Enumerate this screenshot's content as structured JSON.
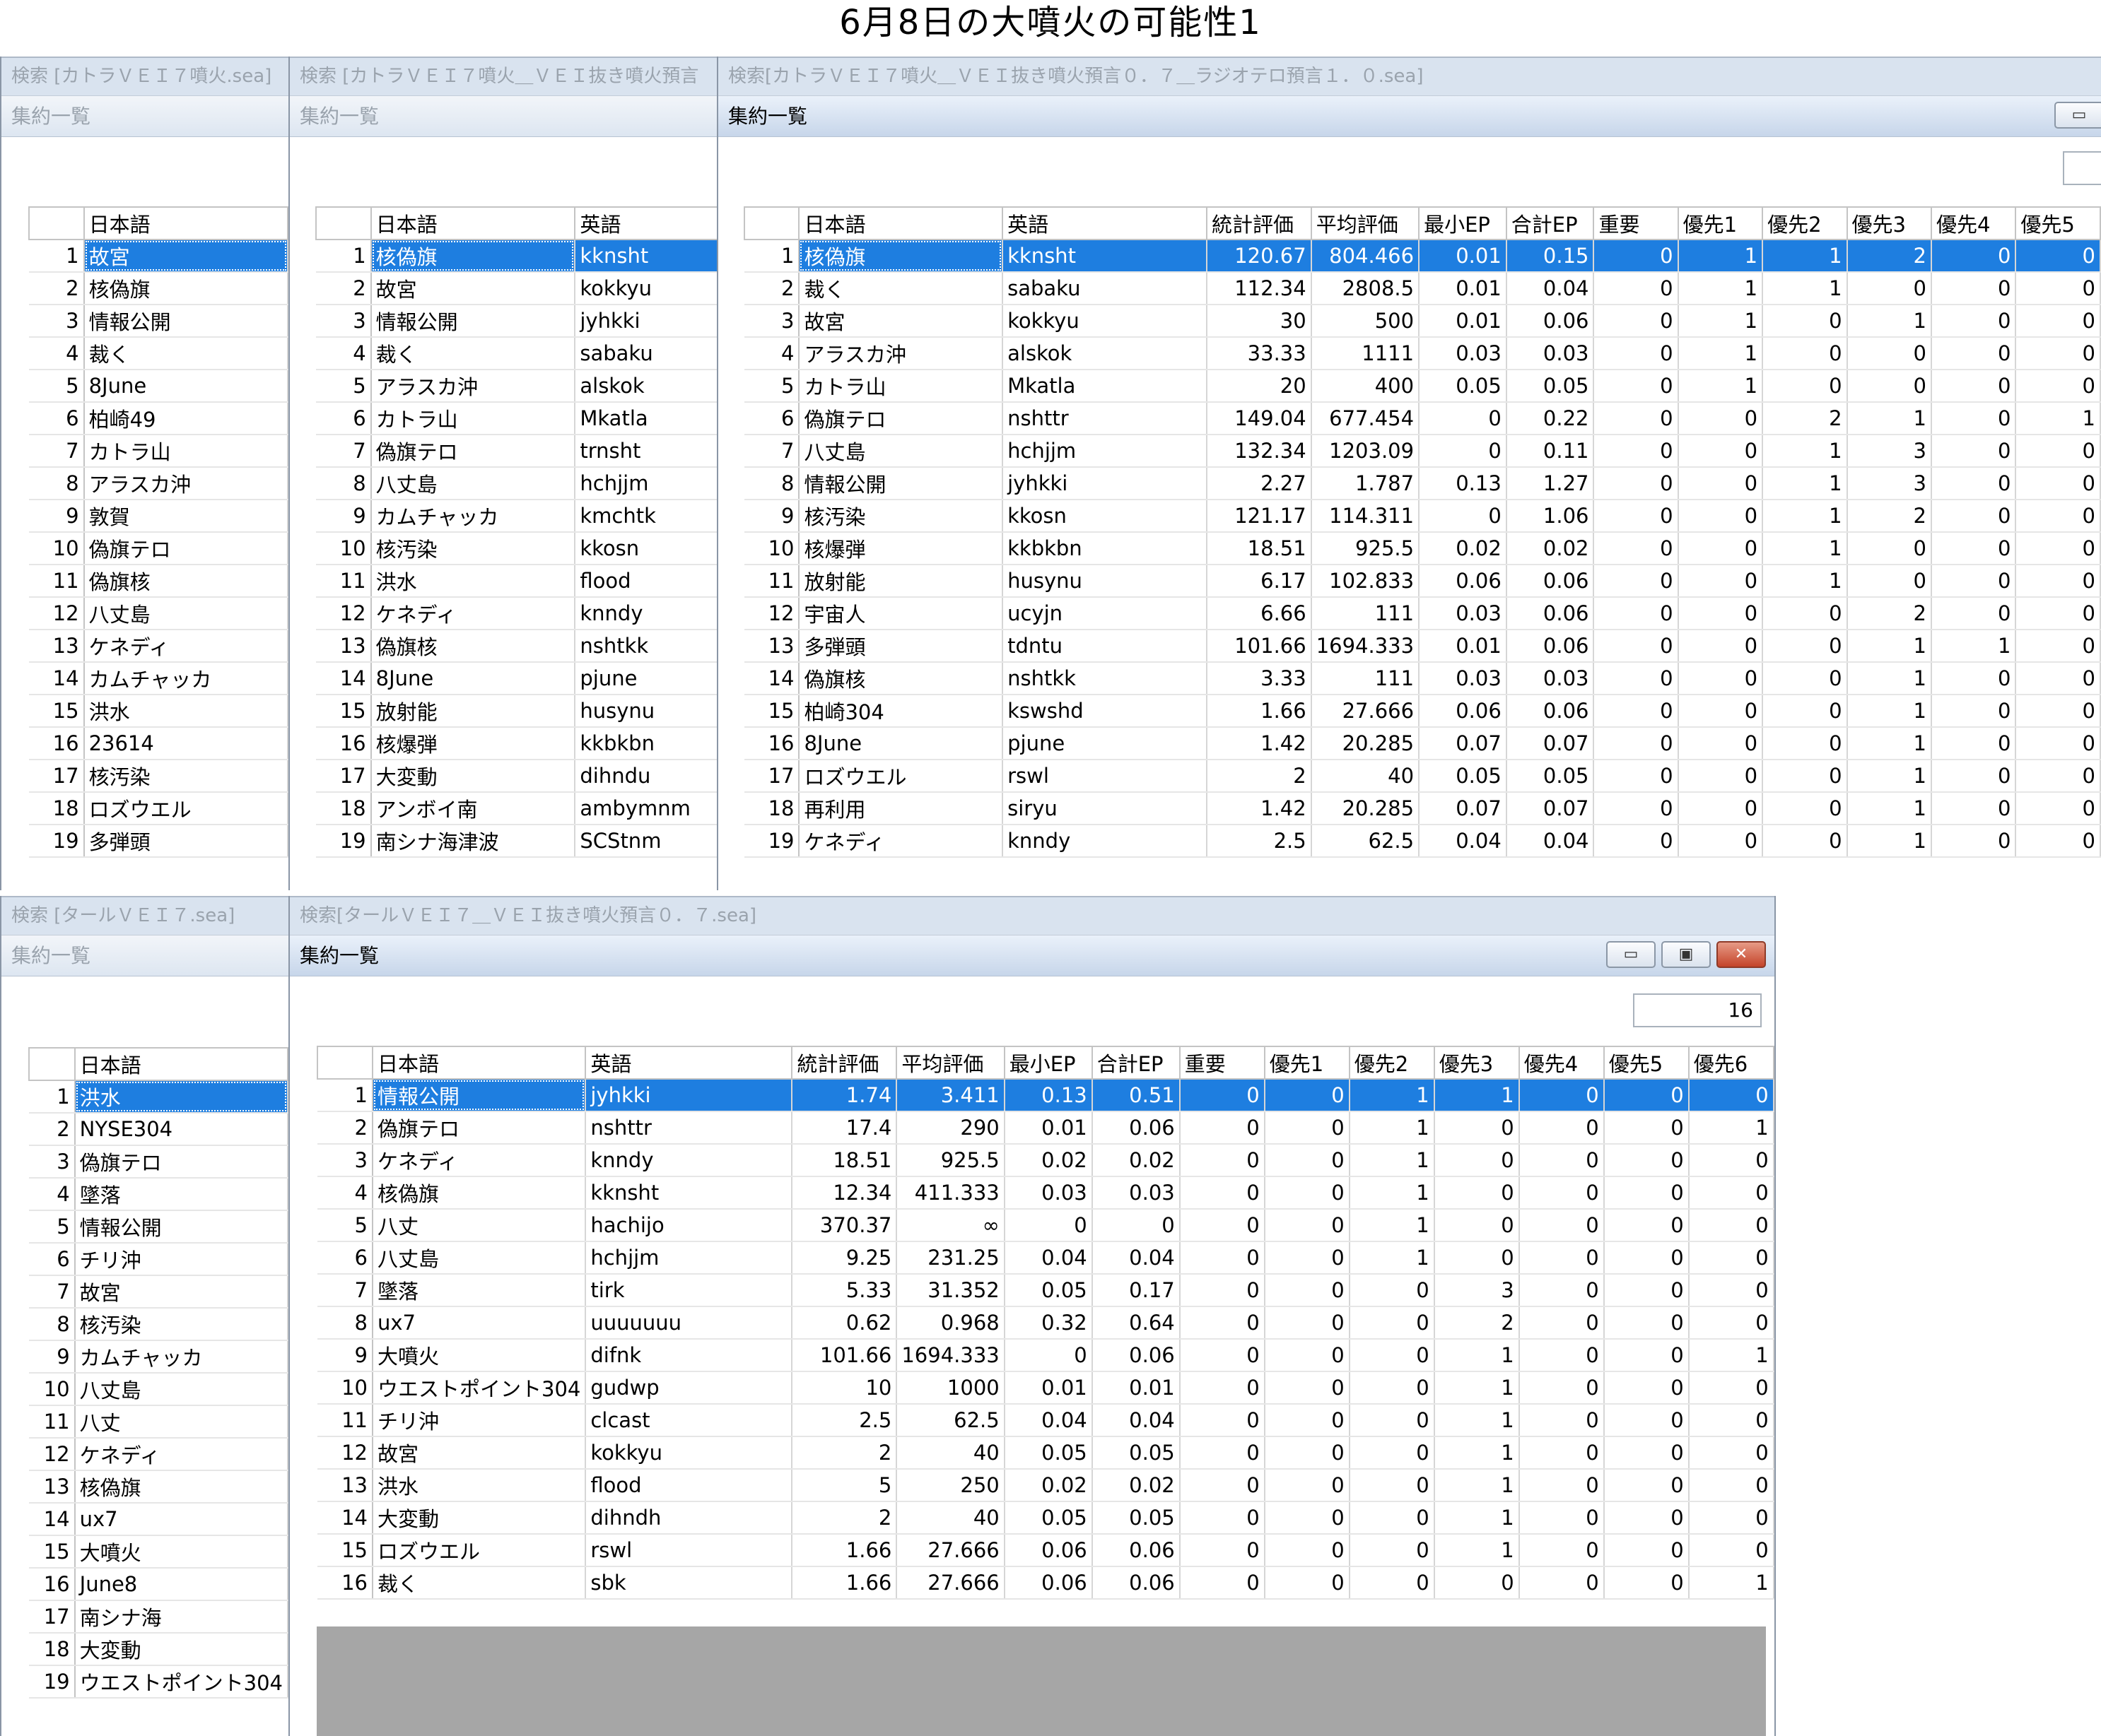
{
  "page_title": "6月8日の大噴火の可能性1",
  "icons": {
    "minimize": "minimize-icon",
    "maximize": "maximize-icon",
    "close": "close-icon"
  },
  "colors": {
    "selection": "#1e7ee0",
    "titlebar": "#d9e3ef",
    "close": "#c4442a",
    "empty_area": "#a6a6a6"
  },
  "win1": {
    "title": "検索 [カトラＶＥＩ７噴火.sea]",
    "subtitle": "集約一覧",
    "headers": [
      "",
      "日本語"
    ],
    "rows": [
      [
        "1",
        "故宮"
      ],
      [
        "2",
        "核偽旗"
      ],
      [
        "3",
        "情報公開"
      ],
      [
        "4",
        "裁く"
      ],
      [
        "5",
        "8June"
      ],
      [
        "6",
        "柏崎49"
      ],
      [
        "7",
        "カトラ山"
      ],
      [
        "8",
        "アラスカ沖"
      ],
      [
        "9",
        "敦賀"
      ],
      [
        "10",
        "偽旗テロ"
      ],
      [
        "11",
        "偽旗核"
      ],
      [
        "12",
        "八丈島"
      ],
      [
        "13",
        "ケネディ"
      ],
      [
        "14",
        "カムチャッカ"
      ],
      [
        "15",
        "洪水"
      ],
      [
        "16",
        "23614"
      ],
      [
        "17",
        "核汚染"
      ],
      [
        "18",
        "ロズウエル"
      ],
      [
        "19",
        "多弾頭"
      ]
    ]
  },
  "win2": {
    "title": "検索 [カトラＶＥＩ７噴火＿ＶＥＩ抜き噴火預言",
    "subtitle": "集約一覧",
    "headers": [
      "",
      "日本語",
      "英語"
    ],
    "rows": [
      [
        "1",
        "核偽旗",
        "kknsht"
      ],
      [
        "2",
        "故宮",
        "kokkyu"
      ],
      [
        "3",
        "情報公開",
        "jyhkki"
      ],
      [
        "4",
        "裁く",
        "sabaku"
      ],
      [
        "5",
        "アラスカ沖",
        "alskok"
      ],
      [
        "6",
        "カトラ山",
        "Mkatla"
      ],
      [
        "7",
        "偽旗テロ",
        "trnsht"
      ],
      [
        "8",
        "八丈島",
        "hchjjm"
      ],
      [
        "9",
        "カムチャッカ",
        "kmchtk"
      ],
      [
        "10",
        "核汚染",
        "kkosn"
      ],
      [
        "11",
        "洪水",
        "flood"
      ],
      [
        "12",
        "ケネディ",
        "knndy"
      ],
      [
        "13",
        "偽旗核",
        "nshtkk"
      ],
      [
        "14",
        "8June",
        "pjune"
      ],
      [
        "15",
        "放射能",
        "husynu"
      ],
      [
        "16",
        "核爆弾",
        "kkbkbn"
      ],
      [
        "17",
        "大変動",
        "dihndu"
      ],
      [
        "18",
        "アンボイ南",
        "ambymnm"
      ],
      [
        "19",
        "南シナ海津波",
        "SCStnm"
      ]
    ]
  },
  "win3": {
    "title": "検索[カトラＶＥＩ７噴火＿ＶＥＩ抜き噴火預言０．７＿ラジオテロ預言１．０.sea]",
    "subtitle": "集約一覧",
    "headers": [
      "",
      "日本語",
      "英語",
      "統計評価",
      "平均評価",
      "最小EP",
      "合計EP",
      "重要",
      "優先1",
      "優先2",
      "優先3",
      "優先4",
      "優先5"
    ],
    "rows": [
      [
        "1",
        "核偽旗",
        "kknsht",
        "120.67",
        "804.466",
        "0.01",
        "0.15",
        "0",
        "1",
        "1",
        "2",
        "0",
        "0"
      ],
      [
        "2",
        "裁く",
        "sabaku",
        "112.34",
        "2808.5",
        "0.01",
        "0.04",
        "0",
        "1",
        "1",
        "0",
        "0",
        "0"
      ],
      [
        "3",
        "故宮",
        "kokkyu",
        "30",
        "500",
        "0.01",
        "0.06",
        "0",
        "1",
        "0",
        "1",
        "0",
        "0"
      ],
      [
        "4",
        "アラスカ沖",
        "alskok",
        "33.33",
        "1111",
        "0.03",
        "0.03",
        "0",
        "1",
        "0",
        "0",
        "0",
        "0"
      ],
      [
        "5",
        "カトラ山",
        "Mkatla",
        "20",
        "400",
        "0.05",
        "0.05",
        "0",
        "1",
        "0",
        "0",
        "0",
        "0"
      ],
      [
        "6",
        "偽旗テロ",
        "nshttr",
        "149.04",
        "677.454",
        "0",
        "0.22",
        "0",
        "0",
        "2",
        "1",
        "0",
        "1"
      ],
      [
        "7",
        "八丈島",
        "hchjjm",
        "132.34",
        "1203.09",
        "0",
        "0.11",
        "0",
        "0",
        "1",
        "3",
        "0",
        "0"
      ],
      [
        "8",
        "情報公開",
        "jyhkki",
        "2.27",
        "1.787",
        "0.13",
        "1.27",
        "0",
        "0",
        "1",
        "3",
        "0",
        "0"
      ],
      [
        "9",
        "核汚染",
        "kkosn",
        "121.17",
        "114.311",
        "0",
        "1.06",
        "0",
        "0",
        "1",
        "2",
        "0",
        "0"
      ],
      [
        "10",
        "核爆弾",
        "kkbkbn",
        "18.51",
        "925.5",
        "0.02",
        "0.02",
        "0",
        "0",
        "1",
        "0",
        "0",
        "0"
      ],
      [
        "11",
        "放射能",
        "husynu",
        "6.17",
        "102.833",
        "0.06",
        "0.06",
        "0",
        "0",
        "1",
        "0",
        "0",
        "0"
      ],
      [
        "12",
        "宇宙人",
        "ucyjn",
        "6.66",
        "111",
        "0.03",
        "0.06",
        "0",
        "0",
        "0",
        "2",
        "0",
        "0"
      ],
      [
        "13",
        "多弾頭",
        "tdntu",
        "101.66",
        "1694.333",
        "0.01",
        "0.06",
        "0",
        "0",
        "0",
        "1",
        "1",
        "0"
      ],
      [
        "14",
        "偽旗核",
        "nshtkk",
        "3.33",
        "111",
        "0.03",
        "0.03",
        "0",
        "0",
        "0",
        "1",
        "0",
        "0"
      ],
      [
        "15",
        "柏崎304",
        "kswshd",
        "1.66",
        "27.666",
        "0.06",
        "0.06",
        "0",
        "0",
        "0",
        "1",
        "0",
        "0"
      ],
      [
        "16",
        "8June",
        "pjune",
        "1.42",
        "20.285",
        "0.07",
        "0.07",
        "0",
        "0",
        "0",
        "1",
        "0",
        "0"
      ],
      [
        "17",
        "ロズウエル",
        "rswl",
        "2",
        "40",
        "0.05",
        "0.05",
        "0",
        "0",
        "0",
        "1",
        "0",
        "0"
      ],
      [
        "18",
        "再利用",
        "siryu",
        "1.42",
        "20.285",
        "0.07",
        "0.07",
        "0",
        "0",
        "0",
        "1",
        "0",
        "0"
      ],
      [
        "19",
        "ケネディ",
        "knndy",
        "2.5",
        "62.5",
        "0.04",
        "0.04",
        "0",
        "0",
        "0",
        "1",
        "0",
        "0"
      ]
    ]
  },
  "win4": {
    "title": "検索 [タールＶＥＩ７.sea]",
    "subtitle": "集約一覧",
    "headers": [
      "",
      "日本語"
    ],
    "rows": [
      [
        "1",
        "洪水"
      ],
      [
        "2",
        "NYSE304"
      ],
      [
        "3",
        "偽旗テロ"
      ],
      [
        "4",
        "墜落"
      ],
      [
        "5",
        "情報公開"
      ],
      [
        "6",
        "チリ沖"
      ],
      [
        "7",
        "故宮"
      ],
      [
        "8",
        "核汚染"
      ],
      [
        "9",
        "カムチャッカ"
      ],
      [
        "10",
        "八丈島"
      ],
      [
        "11",
        "八丈"
      ],
      [
        "12",
        "ケネディ"
      ],
      [
        "13",
        "核偽旗"
      ],
      [
        "14",
        "ux7"
      ],
      [
        "15",
        "大噴火"
      ],
      [
        "16",
        "June8"
      ],
      [
        "17",
        "南シナ海"
      ],
      [
        "18",
        "大変動"
      ],
      [
        "19",
        "ウエストポイント304"
      ]
    ]
  },
  "win5": {
    "title": "検索[タールＶＥＩ７＿ＶＥＩ抜き噴火預言０．７.sea]",
    "subtitle": "集約一覧",
    "count": "16",
    "headers": [
      "",
      "日本語",
      "英語",
      "統計評価",
      "平均評価",
      "最小EP",
      "合計EP",
      "重要",
      "優先1",
      "優先2",
      "優先3",
      "優先4",
      "優先5",
      "優先6"
    ],
    "rows": [
      [
        "1",
        "情報公開",
        "jyhkki",
        "1.74",
        "3.411",
        "0.13",
        "0.51",
        "0",
        "0",
        "1",
        "1",
        "0",
        "0",
        "0"
      ],
      [
        "2",
        "偽旗テロ",
        "nshttr",
        "17.4",
        "290",
        "0.01",
        "0.06",
        "0",
        "0",
        "1",
        "0",
        "0",
        "0",
        "1"
      ],
      [
        "3",
        "ケネディ",
        "knndy",
        "18.51",
        "925.5",
        "0.02",
        "0.02",
        "0",
        "0",
        "1",
        "0",
        "0",
        "0",
        "0"
      ],
      [
        "4",
        "核偽旗",
        "kknsht",
        "12.34",
        "411.333",
        "0.03",
        "0.03",
        "0",
        "0",
        "1",
        "0",
        "0",
        "0",
        "0"
      ],
      [
        "5",
        "八丈",
        "hachijo",
        "370.37",
        "∞",
        "0",
        "0",
        "0",
        "0",
        "1",
        "0",
        "0",
        "0",
        "0"
      ],
      [
        "6",
        "八丈島",
        "hchjjm",
        "9.25",
        "231.25",
        "0.04",
        "0.04",
        "0",
        "0",
        "1",
        "0",
        "0",
        "0",
        "0"
      ],
      [
        "7",
        "墜落",
        "tirk",
        "5.33",
        "31.352",
        "0.05",
        "0.17",
        "0",
        "0",
        "0",
        "3",
        "0",
        "0",
        "0"
      ],
      [
        "8",
        "ux7",
        "uuuuuuu",
        "0.62",
        "0.968",
        "0.32",
        "0.64",
        "0",
        "0",
        "0",
        "2",
        "0",
        "0",
        "0"
      ],
      [
        "9",
        "大噴火",
        "difnk",
        "101.66",
        "1694.333",
        "0",
        "0.06",
        "0",
        "0",
        "0",
        "1",
        "0",
        "0",
        "1"
      ],
      [
        "10",
        "ウエストポイント304",
        "gudwp",
        "10",
        "1000",
        "0.01",
        "0.01",
        "0",
        "0",
        "0",
        "1",
        "0",
        "0",
        "0"
      ],
      [
        "11",
        "チリ沖",
        "clcast",
        "2.5",
        "62.5",
        "0.04",
        "0.04",
        "0",
        "0",
        "0",
        "1",
        "0",
        "0",
        "0"
      ],
      [
        "12",
        "故宮",
        "kokkyu",
        "2",
        "40",
        "0.05",
        "0.05",
        "0",
        "0",
        "0",
        "1",
        "0",
        "0",
        "0"
      ],
      [
        "13",
        "洪水",
        "flood",
        "5",
        "250",
        "0.02",
        "0.02",
        "0",
        "0",
        "0",
        "1",
        "0",
        "0",
        "0"
      ],
      [
        "14",
        "大変動",
        "dihndh",
        "2",
        "40",
        "0.05",
        "0.05",
        "0",
        "0",
        "0",
        "1",
        "0",
        "0",
        "0"
      ],
      [
        "15",
        "ロズウエル",
        "rswl",
        "1.66",
        "27.666",
        "0.06",
        "0.06",
        "0",
        "0",
        "0",
        "1",
        "0",
        "0",
        "0"
      ],
      [
        "16",
        "裁く",
        "sbk",
        "1.66",
        "27.666",
        "0.06",
        "0.06",
        "0",
        "0",
        "0",
        "0",
        "0",
        "0",
        "1"
      ]
    ]
  }
}
